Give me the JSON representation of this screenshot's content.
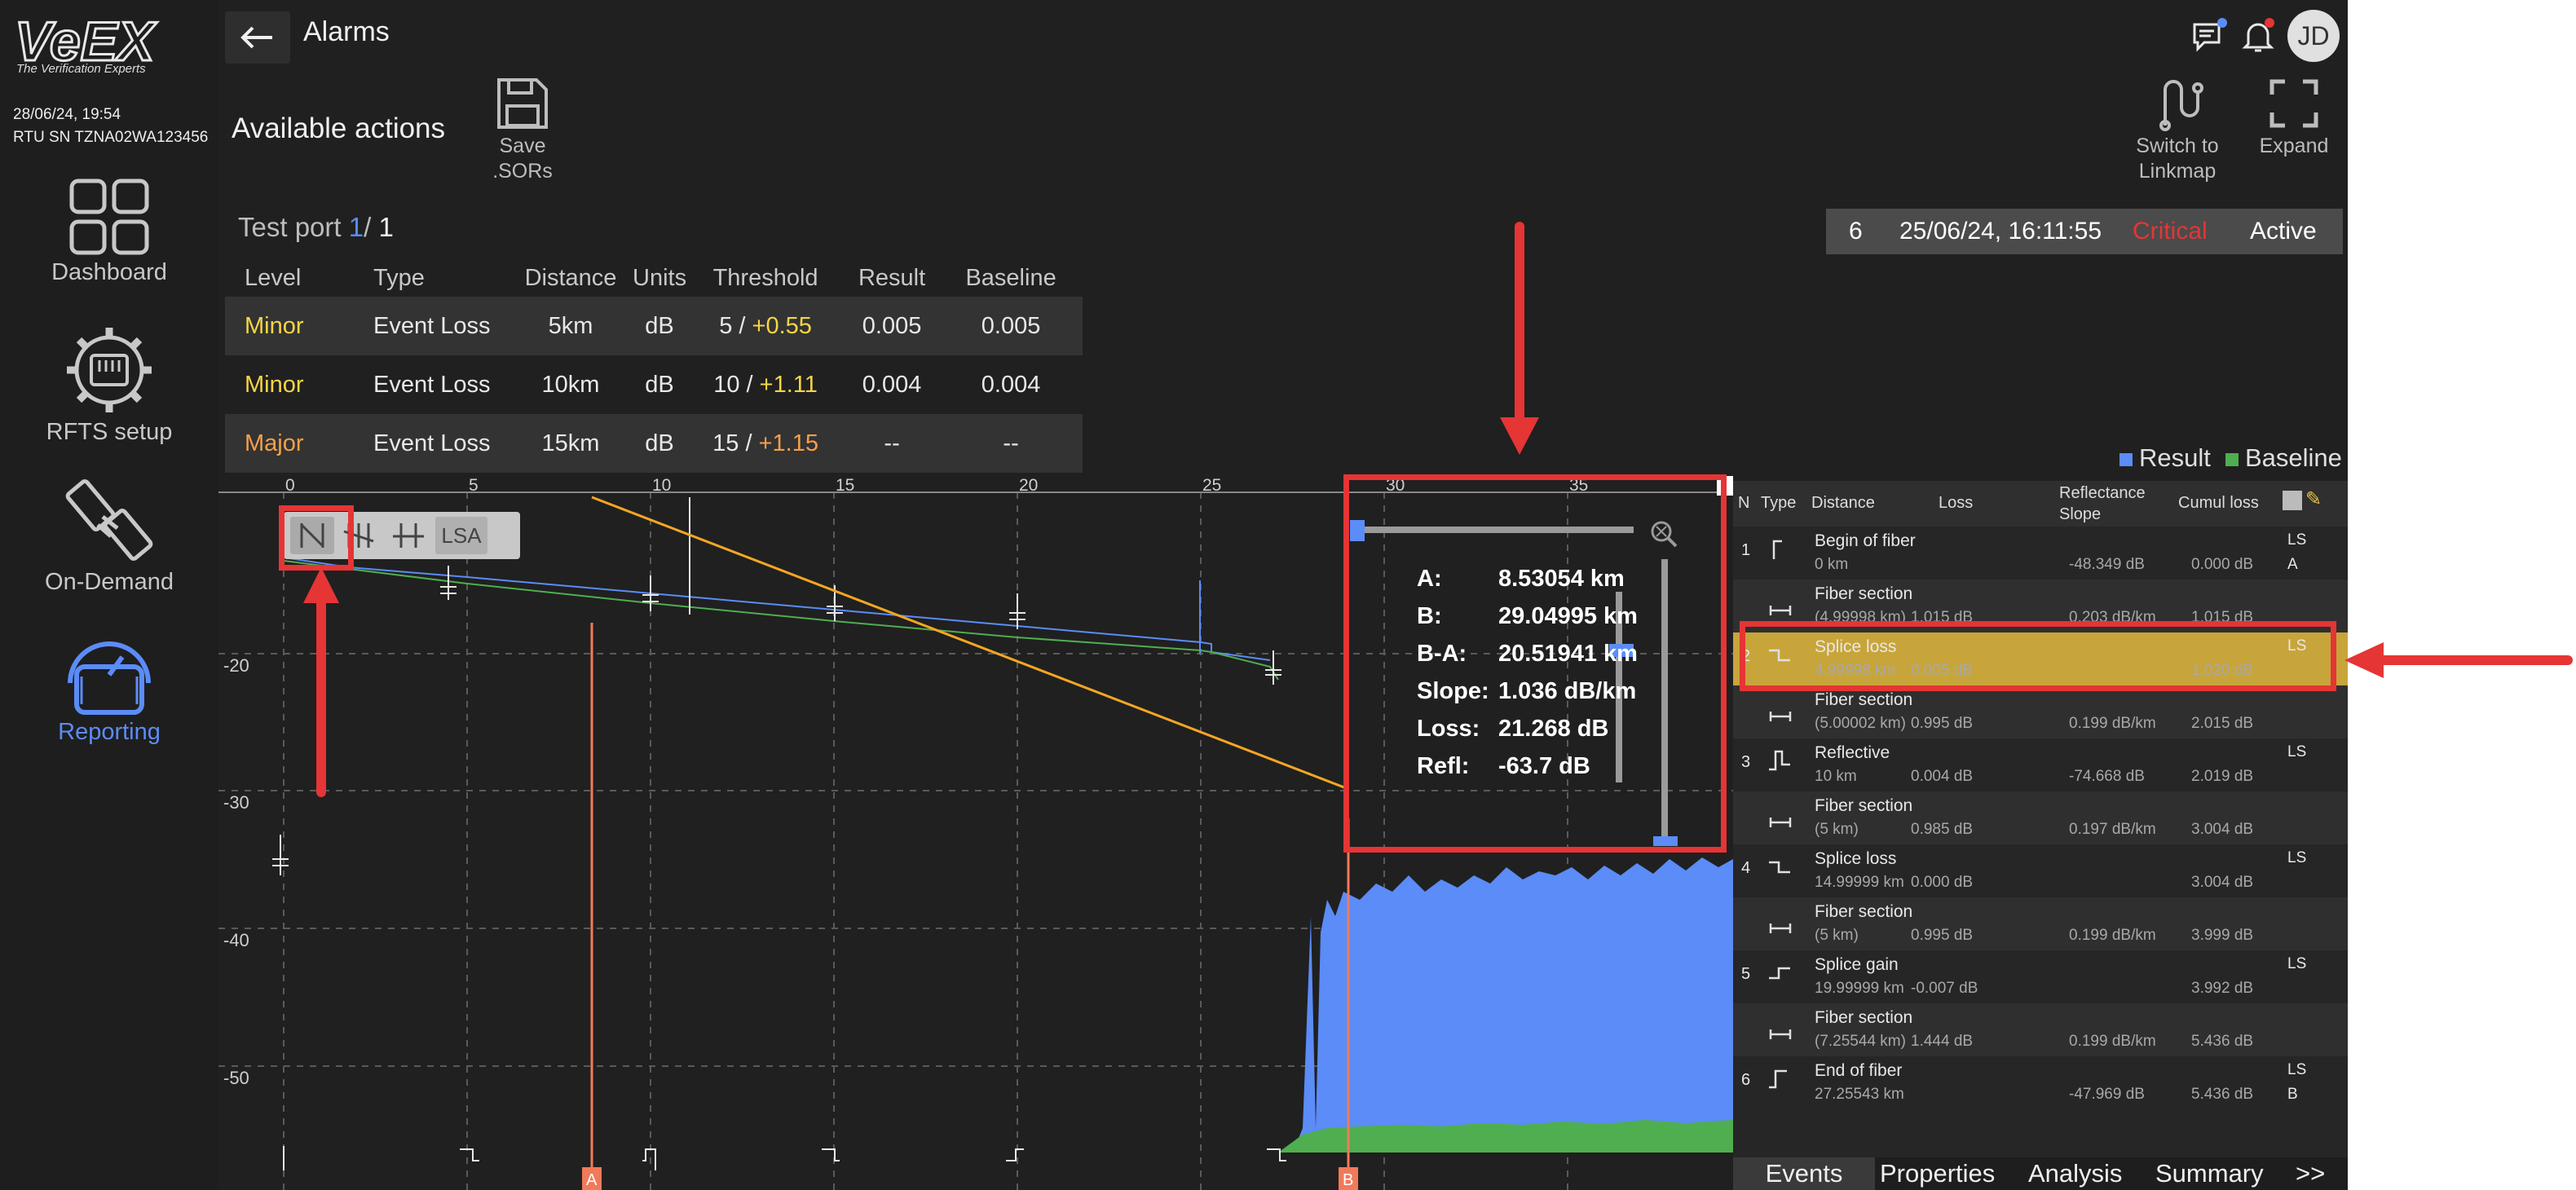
{
  "app": {
    "logo_text": "VeEX",
    "logo_tagline": "The Verification Experts",
    "datetime": "28/06/24, 19:54",
    "rtu_sn": "RTU SN TZNA02WA123456",
    "title": "Alarms",
    "avatar_initials": "JD"
  },
  "sidebar": {
    "items": [
      {
        "label": "Dashboard",
        "icon": "dashboard-grid-icon"
      },
      {
        "label": "RFTS setup",
        "icon": "gear-chip-icon"
      },
      {
        "label": "On-Demand",
        "icon": "on-demand-icon"
      },
      {
        "label": "Reporting",
        "icon": "gauge-icon",
        "active": true
      }
    ]
  },
  "actions": {
    "heading": "Available actions",
    "save_label_1": "Save",
    "save_label_2": ".SORs",
    "switch_label_1": "Switch to",
    "switch_label_2": "Linkmap",
    "expand_label": "Expand"
  },
  "alarm": {
    "id": "6",
    "timestamp": "25/06/24, 16:11:55",
    "severity": "Critical",
    "state": "Active"
  },
  "testport": {
    "label": "Test port",
    "current": "1",
    "sep": "/",
    "total": "1"
  },
  "thresholds": {
    "headers": [
      "Level",
      "Type",
      "Distance",
      "Units",
      "Threshold",
      "Result",
      "Baseline"
    ],
    "rows": [
      {
        "level": "Minor",
        "type": "Event Loss",
        "distance": "5km",
        "units": "dB",
        "thr_a": "5 / ",
        "thr_b": "+0.55",
        "result": "0.005",
        "baseline": "0.005"
      },
      {
        "level": "Minor",
        "type": "Event Loss",
        "distance": "10km",
        "units": "dB",
        "thr_a": "10 / ",
        "thr_b": "+1.11",
        "result": "0.004",
        "baseline": "0.004"
      },
      {
        "level": "Major",
        "type": "Event Loss",
        "distance": "15km",
        "units": "dB",
        "thr_a": "15 / ",
        "thr_b": "+1.15",
        "result": "--",
        "baseline": "--"
      }
    ]
  },
  "legend": {
    "result": "Result",
    "baseline": "Baseline"
  },
  "trace": {
    "x_ticks": [
      "0",
      "5",
      "10",
      "15",
      "20",
      "25",
      "30",
      "35"
    ],
    "y_ticks": [
      "-20",
      "-30",
      "-40",
      "-50"
    ],
    "marker_a": "A",
    "marker_b": "B",
    "lsa_label": "LSA"
  },
  "cursor_info": {
    "a_label": "A:",
    "a_value": "8.53054 km",
    "b_label": "B:",
    "b_value": "29.04995 km",
    "ba_label": "B-A:",
    "ba_value": "20.51941 km",
    "slope_label": "Slope:",
    "slope_value": "1.036 dB/km",
    "loss_label": "Loss:",
    "loss_value": "21.268 dB",
    "refl_label": "Refl:",
    "refl_value": "-63.7 dB"
  },
  "events": {
    "headers": {
      "num": "N",
      "type": "Type",
      "distance": "Distance",
      "loss": "Loss",
      "refl1": "Reflectance",
      "refl2": "Slope",
      "cumul": "Cumul loss"
    },
    "rows": [
      {
        "num": "1",
        "name": "Begin of fiber",
        "dist": "0 km",
        "loss": "",
        "refl": "-48.349 dB",
        "cumul": "0.000 dB",
        "flag1": "LS",
        "flag2": "A",
        "icon": "begin-of-fiber-icon"
      },
      {
        "num": "",
        "name": "Fiber section",
        "dist": "(4.99998 km)",
        "loss": "1.015 dB",
        "refl": "0.203 dB/km",
        "cumul": "1.015 dB",
        "flag1": "",
        "flag2": "",
        "icon": "fiber-section-icon"
      },
      {
        "num": "2",
        "name": "Splice loss",
        "dist": "4.99998 km",
        "loss": "0.005 dB",
        "refl": "",
        "cumul": "1.020 dB",
        "flag1": "LS",
        "flag2": "",
        "icon": "splice-loss-icon",
        "selected": true
      },
      {
        "num": "",
        "name": "Fiber section",
        "dist": "(5.00002 km)",
        "loss": "0.995 dB",
        "refl": "0.199 dB/km",
        "cumul": "2.015 dB",
        "flag1": "",
        "flag2": "",
        "icon": "fiber-section-icon"
      },
      {
        "num": "3",
        "name": "Reflective",
        "dist": "10 km",
        "loss": "0.004 dB",
        "refl": "-74.668 dB",
        "cumul": "2.019 dB",
        "flag1": "LS",
        "flag2": "",
        "icon": "reflective-icon"
      },
      {
        "num": "",
        "name": "Fiber section",
        "dist": "(5 km)",
        "loss": "0.985 dB",
        "refl": "0.197 dB/km",
        "cumul": "3.004 dB",
        "flag1": "",
        "flag2": "",
        "icon": "fiber-section-icon"
      },
      {
        "num": "4",
        "name": "Splice loss",
        "dist": "14.99999 km",
        "loss": "0.000 dB",
        "refl": "",
        "cumul": "3.004 dB",
        "flag1": "LS",
        "flag2": "",
        "icon": "splice-loss-icon"
      },
      {
        "num": "",
        "name": "Fiber section",
        "dist": "(5 km)",
        "loss": "0.995 dB",
        "refl": "0.199 dB/km",
        "cumul": "3.999 dB",
        "flag1": "",
        "flag2": "",
        "icon": "fiber-section-icon"
      },
      {
        "num": "5",
        "name": "Splice gain",
        "dist": "19.99999 km",
        "loss": "-0.007 dB",
        "refl": "",
        "cumul": "3.992 dB",
        "flag1": "LS",
        "flag2": "",
        "icon": "splice-gain-icon"
      },
      {
        "num": "",
        "name": "Fiber section",
        "dist": "(7.25544 km)",
        "loss": "1.444 dB",
        "refl": "0.199 dB/km",
        "cumul": "5.436 dB",
        "flag1": "",
        "flag2": "",
        "icon": "fiber-section-icon"
      },
      {
        "num": "6",
        "name": "End of fiber",
        "dist": "27.25543 km",
        "loss": "",
        "refl": "-47.969 dB",
        "cumul": "5.436 dB",
        "flag1": "LS",
        "flag2": "B",
        "icon": "end-of-fiber-icon"
      }
    ],
    "tabs": [
      "Events",
      "Properties",
      "Analysis",
      "Summary",
      ">>"
    ]
  },
  "colors": {
    "accent_blue": "#5b8cf7",
    "result_trace": "#5b8cf7",
    "baseline_trace": "#4fae4f",
    "marker": "#f07a5a",
    "cursor_line": "#f5a623",
    "critical": "#e53535",
    "minor": "#f5d547",
    "major": "#f5a04a",
    "selected_row": "#c8a53a",
    "annotation": "#e53535"
  }
}
